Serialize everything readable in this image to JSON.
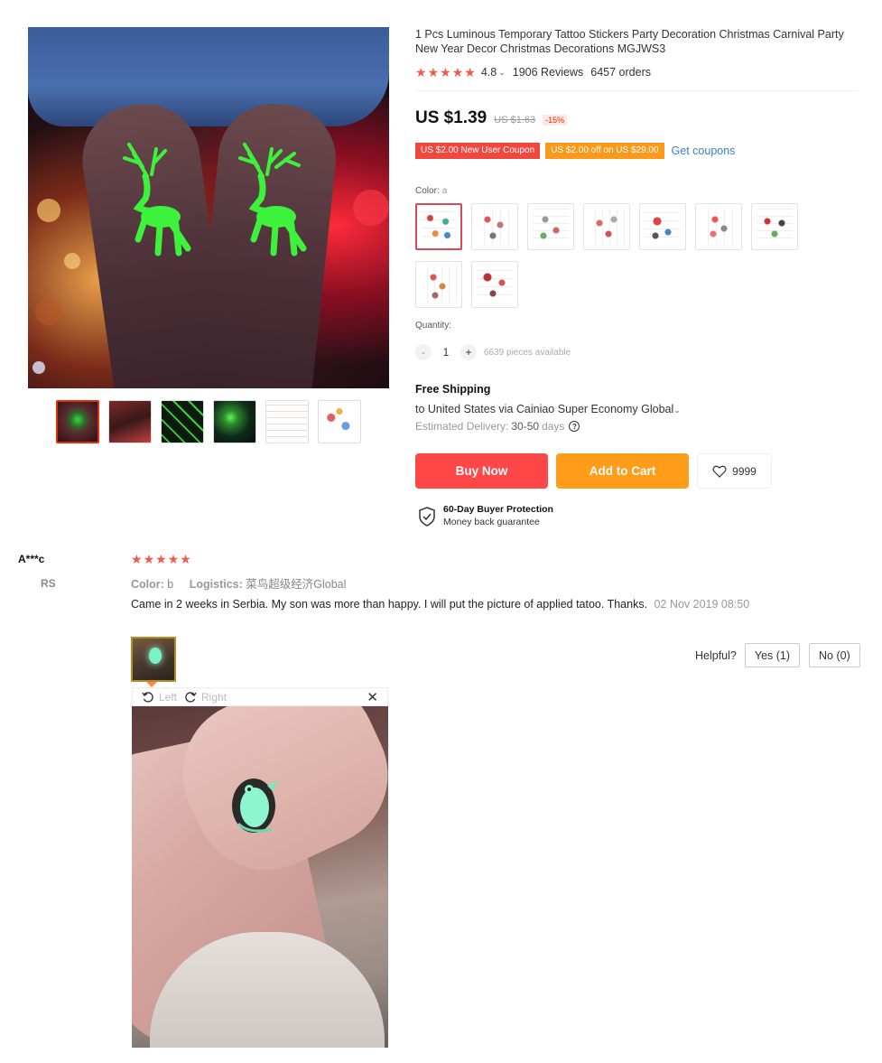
{
  "product": {
    "title": "1 Pcs Luminous Temporary Tattoo Stickers Party Decoration Christmas Carnival Party New Year Decor Christmas Decorations MGJWS3",
    "rating": "4.8",
    "rating_caret": "⌄",
    "reviews": "1906 Reviews",
    "orders": "6457 orders",
    "price": "US $1.39",
    "old_price": "US $1.63",
    "discount": "-15%",
    "coupons": {
      "new_user": "US $2.00 New User Coupon",
      "off": "US $2.00 off on US $29.00",
      "get_label": "Get coupons"
    },
    "color": {
      "label": "Color:",
      "value": "a"
    },
    "quantity": {
      "label": "Quantity:",
      "value": "1",
      "minus": "-",
      "plus": "+",
      "available": "6639 pieces available"
    },
    "shipping": {
      "title": "Free Shipping",
      "line": "to United States via Cainiao Super Economy Global",
      "caret": "⌄",
      "delivery_label": "Estimated Delivery:",
      "delivery_value": "30-50",
      "delivery_unit": "days",
      "help": "?"
    },
    "buttons": {
      "buy": "Buy Now",
      "cart": "Add to Cart",
      "wish_count": "9999"
    },
    "protection": {
      "title": "60-Day Buyer Protection",
      "subtitle": "Money back guarantee"
    }
  },
  "review": {
    "user": "A***c",
    "country": "RS",
    "color_label": "Color:",
    "color_value": "b",
    "logistics_label": "Logistics:",
    "logistics_value": "菜鸟超级经济Global",
    "text": "Came in 2 weeks in Serbia. My son was more than happy. I will put the picture of applied tatoo. Thanks.",
    "date": "02 Nov 2019 08:50",
    "helpful_label": "Helpful?",
    "yes": "Yes (1)",
    "no": "No (0)",
    "viewer": {
      "left": "Left",
      "right": "Right",
      "close": "✕"
    }
  },
  "colors": {
    "accent_red": "#ff4747",
    "accent_orange": "#ff9c1a",
    "star": "#f25a4a",
    "link": "#3b82c4"
  }
}
